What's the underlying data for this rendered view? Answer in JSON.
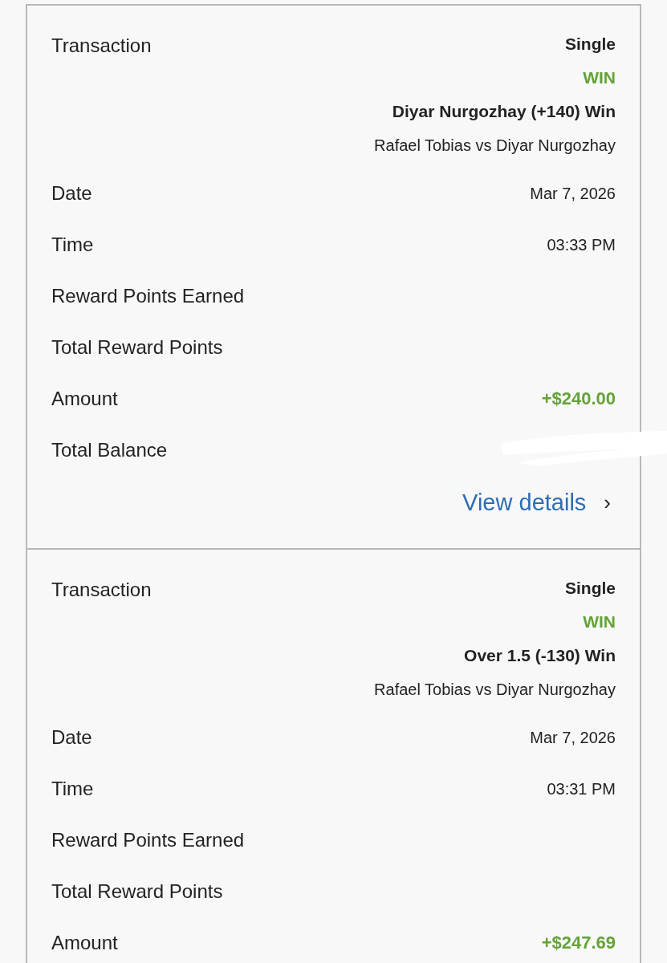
{
  "transactions": [
    {
      "label": "Transaction",
      "bet_type": "Single",
      "result": "WIN",
      "color": "#64a338",
      "selection": "Diyar Nurgozhay (+140) Win",
      "event": "Rafael Tobias vs Diyar Nurgozhay",
      "rows": [
        {
          "label": "Date",
          "kind": "plain",
          "value": "Mar 7, 2026"
        },
        {
          "label": "Time",
          "kind": "plain",
          "value": "03:33 PM"
        },
        {
          "label": "Reward Points Earned",
          "kind": "plain"
        },
        {
          "label": "Total Reward Points",
          "kind": "plain"
        },
        {
          "label": "Amount",
          "kind": "amount",
          "value": "+$240.00"
        },
        {
          "label": "Total Balance",
          "kind": "redacted"
        }
      ],
      "link": {
        "label": "View details",
        "chevron": "›"
      }
    },
    {
      "label": "Transaction",
      "bet_type": "Single",
      "result": "WIN",
      "color": "#64a338",
      "selection": "Over 1.5 (-130) Win",
      "event": "Rafael Tobias vs Diyar Nurgozhay",
      "rows": [
        {
          "label": "Date",
          "kind": "plain",
          "value": "Mar 7, 2026"
        },
        {
          "label": "Time",
          "kind": "plain",
          "value": "03:31 PM"
        },
        {
          "label": "Reward Points Earned",
          "kind": "plain"
        },
        {
          "label": "Total Reward Points",
          "kind": "plain"
        },
        {
          "label": "Amount",
          "kind": "amount",
          "value": "+$247.69"
        }
      ]
    }
  ]
}
